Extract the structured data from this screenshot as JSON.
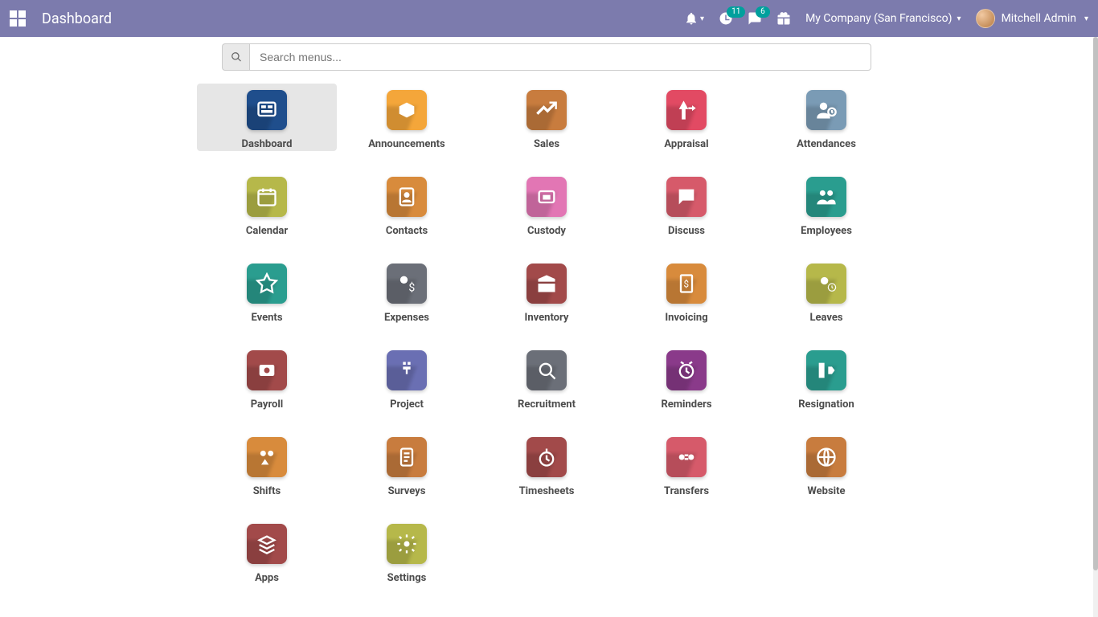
{
  "header": {
    "title": "Dashboard",
    "activity_badge": "11",
    "messages_badge": "6",
    "company": "My Company (San Francisco)",
    "user": "Mitchell Admin"
  },
  "search": {
    "placeholder": "Search menus..."
  },
  "apps": [
    {
      "label": "Dashboard",
      "color": "#1f4e8c",
      "icon": "dashboard",
      "selected": true
    },
    {
      "label": "Announcements",
      "color": "#f4a63a",
      "icon": "announcement"
    },
    {
      "label": "Sales",
      "color": "#c87c3e",
      "icon": "sales"
    },
    {
      "label": "Appraisal",
      "color": "#e24a63",
      "icon": "appraisal"
    },
    {
      "label": "Attendances",
      "color": "#7a9bb5",
      "icon": "attendance"
    },
    {
      "label": "Calendar",
      "color": "#b6b84a",
      "icon": "calendar"
    },
    {
      "label": "Contacts",
      "color": "#d88b3c",
      "icon": "contacts"
    },
    {
      "label": "Custody",
      "color": "#e276b4",
      "icon": "custody"
    },
    {
      "label": "Discuss",
      "color": "#d65a6a",
      "icon": "discuss"
    },
    {
      "label": "Employees",
      "color": "#2a9d8f",
      "icon": "employees"
    },
    {
      "label": "Events",
      "color": "#2a9d8f",
      "icon": "events"
    },
    {
      "label": "Expenses",
      "color": "#6b6f78",
      "icon": "expenses"
    },
    {
      "label": "Inventory",
      "color": "#a24a4a",
      "icon": "inventory"
    },
    {
      "label": "Invoicing",
      "color": "#d88b3c",
      "icon": "invoicing"
    },
    {
      "label": "Leaves",
      "color": "#b6b84a",
      "icon": "leaves"
    },
    {
      "label": "Payroll",
      "color": "#a24a4a",
      "icon": "payroll"
    },
    {
      "label": "Project",
      "color": "#6a6fb3",
      "icon": "project"
    },
    {
      "label": "Recruitment",
      "color": "#6b6f78",
      "icon": "recruitment"
    },
    {
      "label": "Reminders",
      "color": "#8a3a8a",
      "icon": "reminders"
    },
    {
      "label": "Resignation",
      "color": "#2a9d8f",
      "icon": "resignation"
    },
    {
      "label": "Shifts",
      "color": "#d88b3c",
      "icon": "shifts"
    },
    {
      "label": "Surveys",
      "color": "#c87c3e",
      "icon": "surveys"
    },
    {
      "label": "Timesheets",
      "color": "#a24a4a",
      "icon": "timesheets"
    },
    {
      "label": "Transfers",
      "color": "#d65a6a",
      "icon": "transfers"
    },
    {
      "label": "Website",
      "color": "#c87c3e",
      "icon": "website"
    },
    {
      "label": "Apps",
      "color": "#a24a4a",
      "icon": "apps"
    },
    {
      "label": "Settings",
      "color": "#b6b84a",
      "icon": "settings"
    }
  ]
}
